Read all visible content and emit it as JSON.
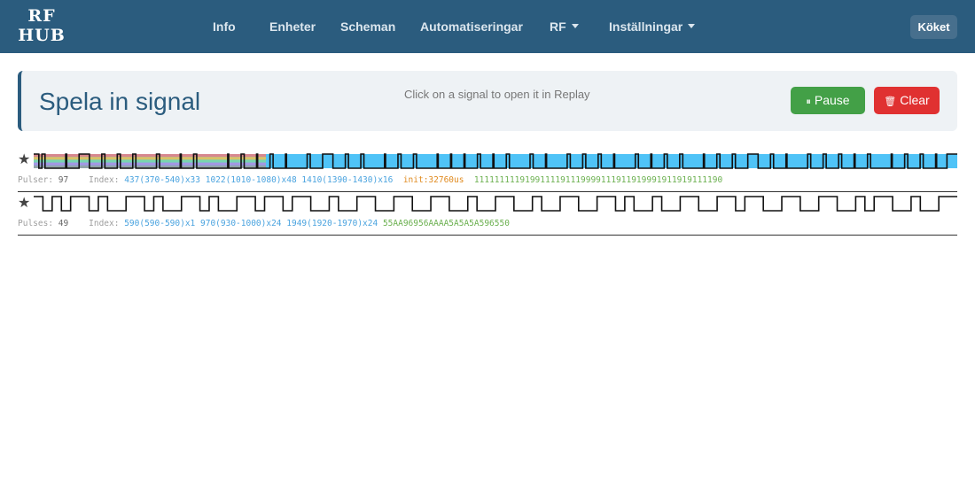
{
  "brand": {
    "line1": "RF",
    "line2": "HUB"
  },
  "nav": {
    "items": [
      "Info",
      "Enheter",
      "Scheman",
      "Automatiseringar",
      "RF",
      "Inställningar"
    ],
    "room": "Köket"
  },
  "header": {
    "title": "Spela in signal",
    "hint": "Click on a signal to open it in Replay",
    "pause_label": "Pause",
    "clear_label": "Clear"
  },
  "colors": {
    "navbar": "#2b5c7e",
    "pause": "#43a047",
    "clear": "#e03131",
    "signal_fill": "#4fc3f7",
    "index": "#4aa3df",
    "init": "#e08a1e",
    "code": "#6bb04f"
  },
  "signals": [
    {
      "pulse_label": "Pulser:",
      "pulse_count": "97",
      "index_label": "Index:",
      "indexes": [
        "437(370-540)x33",
        "1022(1010-1080)x48",
        "1410(1390-1430)x16"
      ],
      "init": "init:32760us",
      "code": "1111111119199111191119999111911919991911919111190",
      "stacked": true,
      "widths": [
        5,
        3,
        3,
        20,
        1,
        12,
        10,
        12,
        3,
        12,
        3,
        12,
        3,
        20,
        3,
        20,
        1,
        12,
        3,
        30,
        1,
        12,
        3,
        12,
        1,
        12,
        3,
        12,
        1,
        20,
        3,
        12,
        10,
        12,
        3,
        12,
        3,
        20,
        1,
        12,
        3,
        12,
        3,
        20,
        1,
        12,
        1,
        12,
        1,
        12,
        3,
        12,
        1,
        12,
        3,
        20,
        3,
        12,
        1,
        20,
        3,
        12,
        3,
        12,
        3,
        12,
        1,
        20,
        3,
        12,
        1,
        12,
        3,
        12,
        3,
        20,
        1,
        12,
        3,
        12,
        3,
        12,
        10,
        12,
        3,
        12,
        1,
        20,
        3,
        12,
        3,
        12,
        3,
        12,
        1,
        12,
        3,
        20,
        1,
        12,
        3,
        12,
        3,
        12,
        1,
        10,
        10
      ]
    },
    {
      "pulse_label": "Pulses:",
      "pulse_count": "49",
      "index_label": "Index:",
      "indexes": [
        "590(590-590)x1",
        "970(930-1000)x24",
        "1949(1920-1970)x24"
      ],
      "code": "55AA96956AAAA5A5A5A596550",
      "stacked": false,
      "widths": [
        1,
        1,
        1,
        1,
        2,
        1,
        1,
        2,
        2,
        1,
        1,
        2,
        2,
        1,
        1,
        2,
        2,
        1,
        2,
        1,
        2,
        2,
        1,
        2,
        2,
        2,
        2,
        2,
        2,
        2,
        1,
        2,
        2,
        2,
        1,
        2,
        2,
        2,
        2,
        1,
        1,
        2,
        1,
        2,
        2,
        2,
        2,
        1,
        2,
        2,
        2,
        2,
        2,
        2,
        1,
        1,
        2,
        2,
        1,
        2,
        2
      ]
    }
  ]
}
